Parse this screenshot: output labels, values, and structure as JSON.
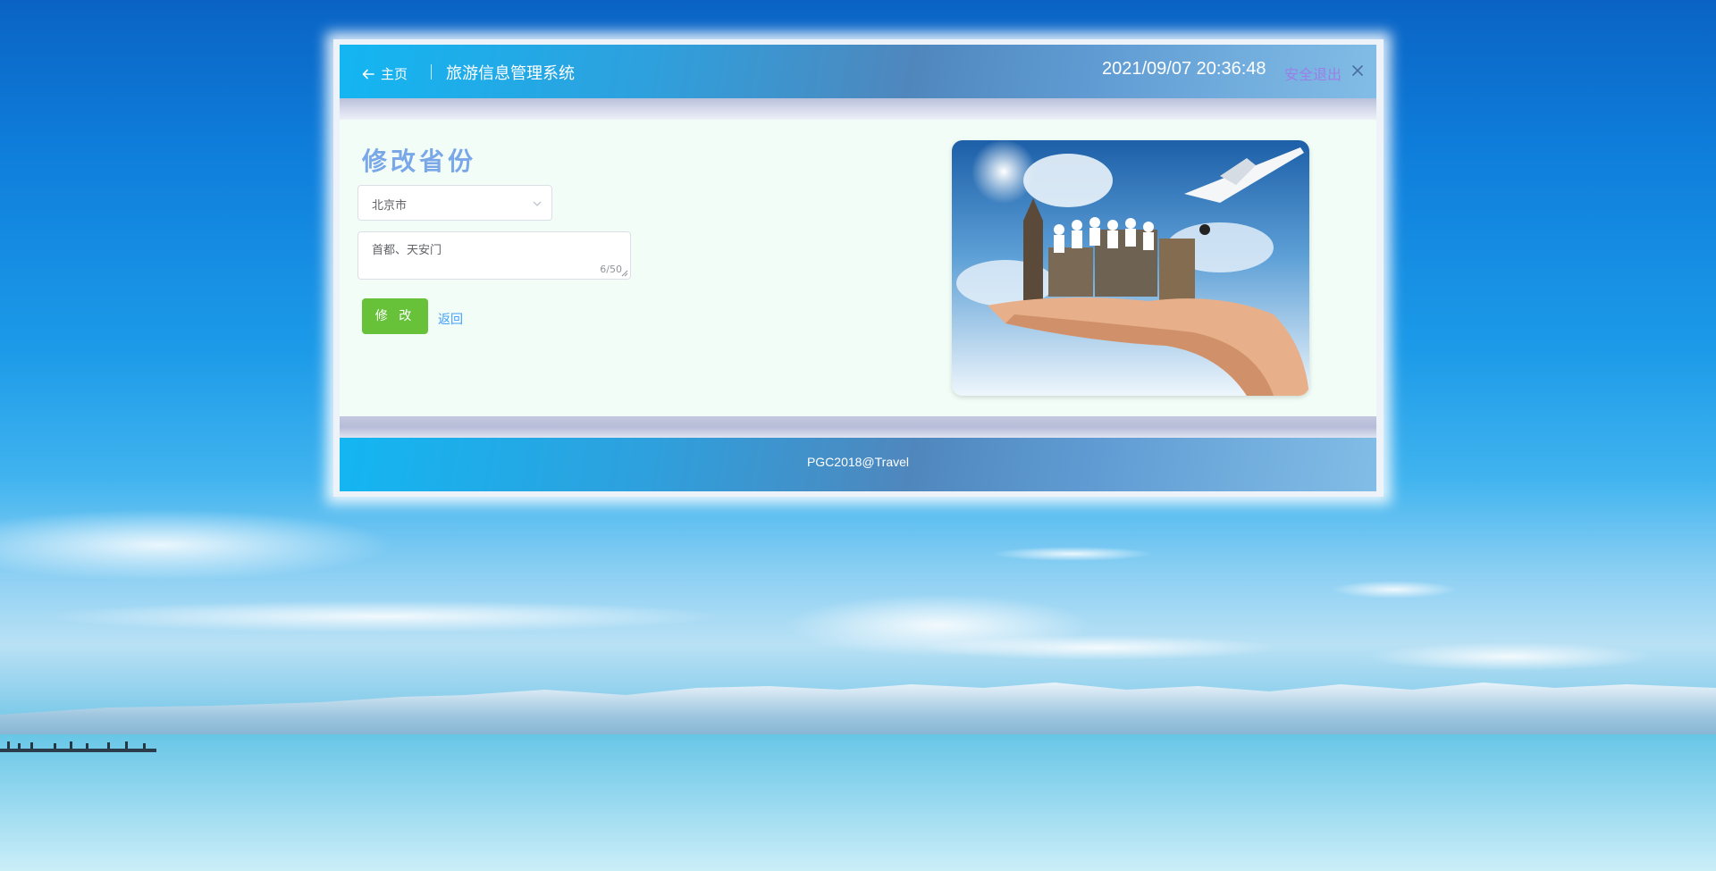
{
  "header": {
    "back_label": "主页",
    "system_title": "旅游信息管理系统",
    "datetime": "2021/09/07 20:36:48",
    "logout_label": "安全退出"
  },
  "form": {
    "title": "修改省份",
    "province_select": {
      "value": "北京市"
    },
    "description": {
      "value": "首都、天安门",
      "counter": "6/50"
    },
    "submit_label": "修 改",
    "back_link": "返回"
  },
  "footer": {
    "text": "PGC2018@Travel"
  },
  "colors": {
    "header_gradient": [
      "#13b6f2",
      "#4f87bd",
      "#82bde7"
    ],
    "title": "#7aa7e8",
    "submit": "#67c23a",
    "link": "#409eff",
    "logout": "#9b7fe6"
  },
  "icons": {
    "back": "arrow-left-icon",
    "close": "close-icon",
    "select": "chevron-down-icon"
  }
}
